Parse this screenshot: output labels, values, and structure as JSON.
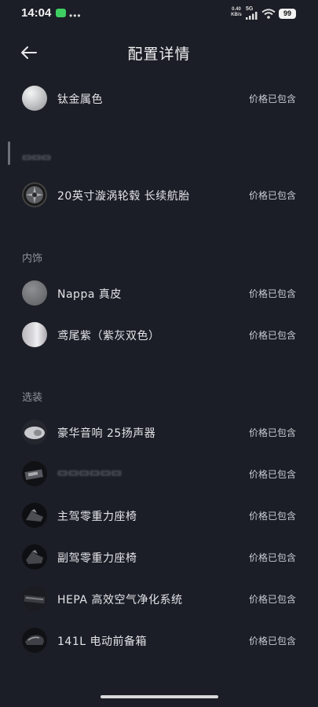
{
  "status_bar": {
    "time": "14:04",
    "net_speed_value": "0.40",
    "net_speed_unit": "KB/s",
    "net_type": "5G",
    "battery": "99"
  },
  "header": {
    "title": "配置详情"
  },
  "exterior": {
    "section_title": "▭▭▭",
    "items": [
      {
        "label": "钛金属色",
        "price": "价格已包含",
        "icon": "paint-swatch-silver"
      },
      {
        "label": "20英寸漩涡轮毂 长续航胎",
        "price": "价格已包含",
        "icon": "wheel-rim"
      }
    ]
  },
  "interior": {
    "section_title": "内饰",
    "items": [
      {
        "label": "Nappa 真皮",
        "price": "价格已包含",
        "icon": "leather-swatch-gray"
      },
      {
        "label": "鸢尾紫（紫灰双色）",
        "price": "价格已包含",
        "icon": "interior-color-swatch"
      }
    ]
  },
  "options": {
    "section_title": "选装",
    "items": [
      {
        "label": "豪华音响 25扬声器",
        "price": "价格已包含",
        "icon": "speaker"
      },
      {
        "label": "▭▭▭▭▭▭",
        "price": "价格已包含",
        "icon": "package-obscured"
      },
      {
        "label": "主驾零重力座椅",
        "price": "价格已包含",
        "icon": "seat"
      },
      {
        "label": "副驾零重力座椅",
        "price": "价格已包含",
        "icon": "seat"
      },
      {
        "label": "HEPA 高效空气净化系统",
        "price": "价格已包含",
        "icon": "air-filter"
      },
      {
        "label": "141L 电动前备箱",
        "price": "价格已包含",
        "icon": "front-trunk"
      }
    ]
  },
  "colors": {
    "background": "#1b1e26",
    "text_primary": "#e3e5e9",
    "text_secondary": "#8d919a"
  }
}
